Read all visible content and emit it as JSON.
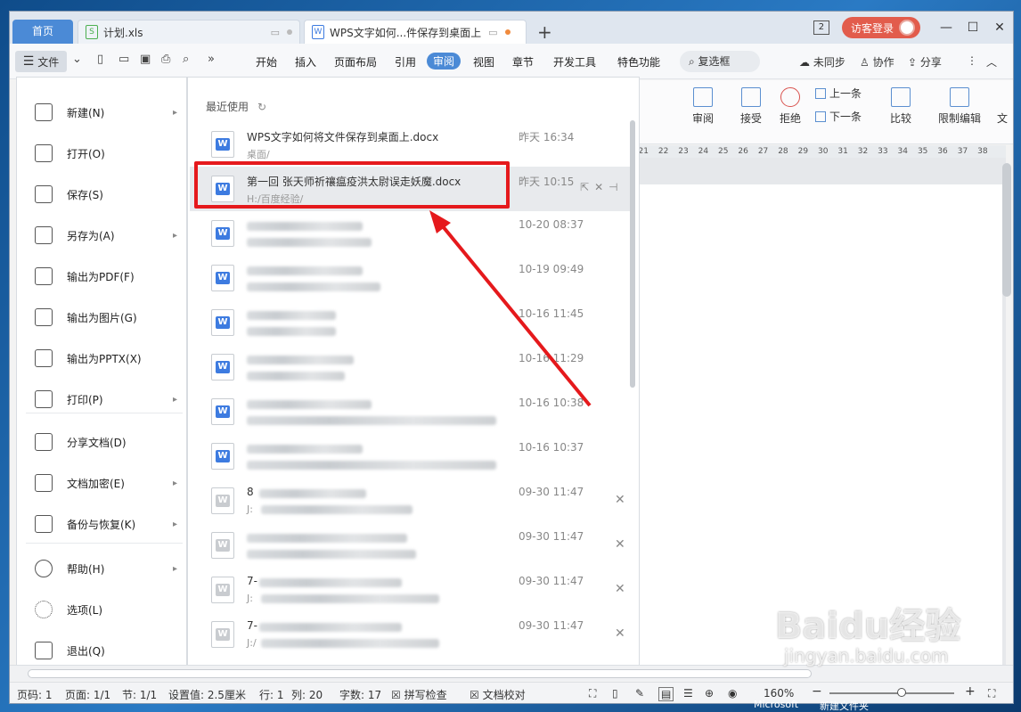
{
  "tabs": {
    "home": "首页",
    "xls": "计划.xls",
    "doc": "WPS文字如何...件保存到桌面上",
    "new_tab": "+"
  },
  "window": {
    "count_badge": "2",
    "login": "访客登录",
    "min": "—",
    "max": "☐",
    "close": "✕"
  },
  "menubar": {
    "file": "文件",
    "items": [
      "开始",
      "插入",
      "页面布局",
      "引用",
      "审阅",
      "视图",
      "章节",
      "开发工具",
      "特色功能"
    ],
    "search": "复选框",
    "sync": "未同步",
    "collab": "协作",
    "share": "分享"
  },
  "ribbon": {
    "review": "审阅",
    "accept": "接受",
    "reject": "拒绝",
    "prev": "上一条",
    "next": "下一条",
    "compare": "比较",
    "restrict": "限制编辑",
    "wen": "文"
  },
  "ruler_ticks": [
    "21",
    "22",
    "23",
    "24",
    "25",
    "26",
    "27",
    "28",
    "29",
    "30",
    "31",
    "32",
    "33",
    "34",
    "35",
    "36",
    "37",
    "38"
  ],
  "backstage": [
    {
      "label": "新建(N)",
      "arrow": true
    },
    {
      "label": "打开(O)",
      "arrow": false
    },
    {
      "label": "保存(S)",
      "arrow": false
    },
    {
      "label": "另存为(A)",
      "arrow": true
    },
    {
      "label": "输出为PDF(F)",
      "arrow": false
    },
    {
      "label": "输出为图片(G)",
      "arrow": false
    },
    {
      "label": "输出为PPTX(X)",
      "arrow": false
    },
    {
      "label": "打印(P)",
      "arrow": true
    },
    {
      "label": "分享文档(D)",
      "arrow": false
    },
    {
      "label": "文档加密(E)",
      "arrow": true
    },
    {
      "label": "备份与恢复(K)",
      "arrow": true
    },
    {
      "label": "帮助(H)",
      "arrow": true
    },
    {
      "label": "选项(L)",
      "arrow": false
    },
    {
      "label": "退出(Q)",
      "arrow": false
    }
  ],
  "recent": {
    "title": "最近使用",
    "files": [
      {
        "name": "WPS文字如何将文件保存到桌面上.docx",
        "path": "桌面/",
        "time": "昨天 16:34"
      },
      {
        "name": "第一回 张天师祈禳瘟疫洪太尉误走妖魔.docx",
        "path": "H:/百度经验/",
        "time": "昨天 10:15"
      },
      {
        "name": "",
        "path": "",
        "time": "10-20 08:37"
      },
      {
        "name": "",
        "path": "",
        "time": "10-19 09:49"
      },
      {
        "name": "",
        "path": "",
        "time": "10-16 11:45"
      },
      {
        "name": "",
        "path": "",
        "time": "10-16 11:29"
      },
      {
        "name": "",
        "path": "",
        "time": "10-16 10:38"
      },
      {
        "name": "",
        "path": "",
        "time": "10-16 10:37"
      },
      {
        "name": "8",
        "path": "J:",
        "time": "09-30 11:47"
      },
      {
        "name": "",
        "path": "",
        "time": "09-30 11:47"
      },
      {
        "name": "7-",
        "path": "J:",
        "time": "09-30 11:47"
      },
      {
        "name": "7-",
        "path": "J:/",
        "time": "09-30 11:47"
      }
    ]
  },
  "statusbar": {
    "page_code": "页码: 1",
    "pages": "页面: 1/1",
    "section": "节: 1/1",
    "setting": "设置值: 2.5厘米",
    "line": "行: 1",
    "col": "列: 20",
    "words": "字数: 17",
    "spell": "拼写检查",
    "proof": "文档校对",
    "zoom": "160%"
  },
  "watermark": {
    "brand": "Baidu经验",
    "url": "jingyan.baidu.com"
  },
  "taskbar": {
    "left": "Microsoft",
    "right": "新建文件夹"
  }
}
